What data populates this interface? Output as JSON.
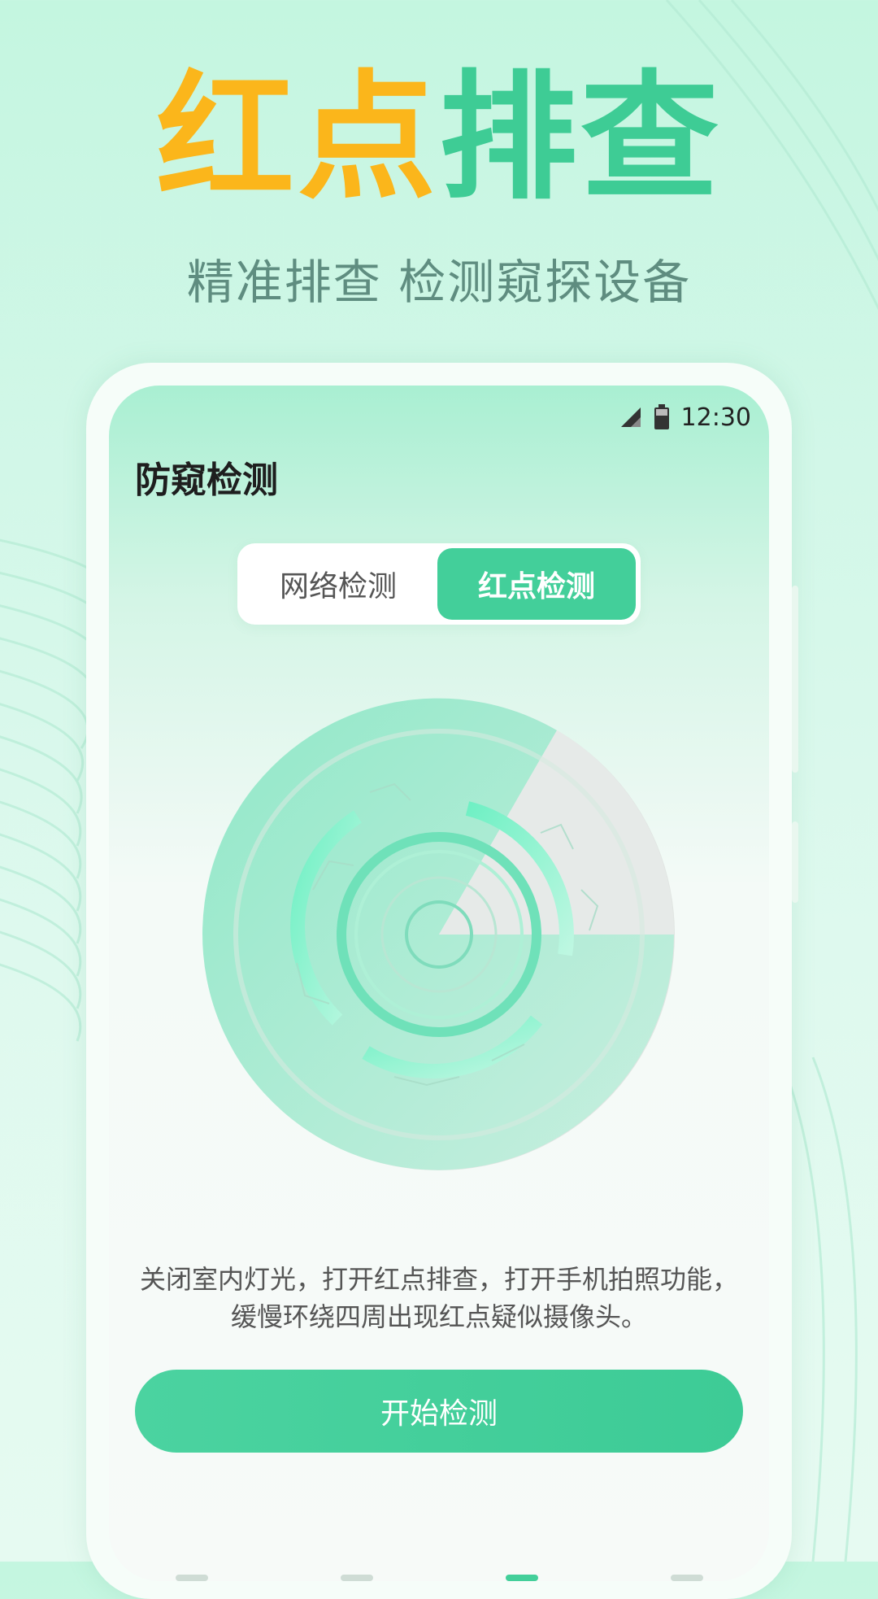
{
  "headline": {
    "part_a": "红点",
    "part_b": "排查"
  },
  "subtitle": "精准排查 检测窥探设备",
  "status_bar": {
    "time": "12:30",
    "signal_icon": "signal-icon",
    "battery_icon": "battery-icon"
  },
  "app": {
    "title": "防窥检测",
    "tabs": [
      {
        "label": "网络检测",
        "active": false
      },
      {
        "label": "红点检测",
        "active": true
      }
    ],
    "radar_icon": "radar-scan-icon",
    "instructions_line1": "关闭室内灯光，打开红点排查，打开手机拍照功能，",
    "instructions_line2": "缓慢环绕四周出现红点疑似摄像头。",
    "start_button": "开始检测"
  },
  "colors": {
    "accent_green": "#43cf9a",
    "headline_orange": "#fbb61b",
    "headline_green": "#3ecc95",
    "subtitle": "#5f8d80"
  }
}
